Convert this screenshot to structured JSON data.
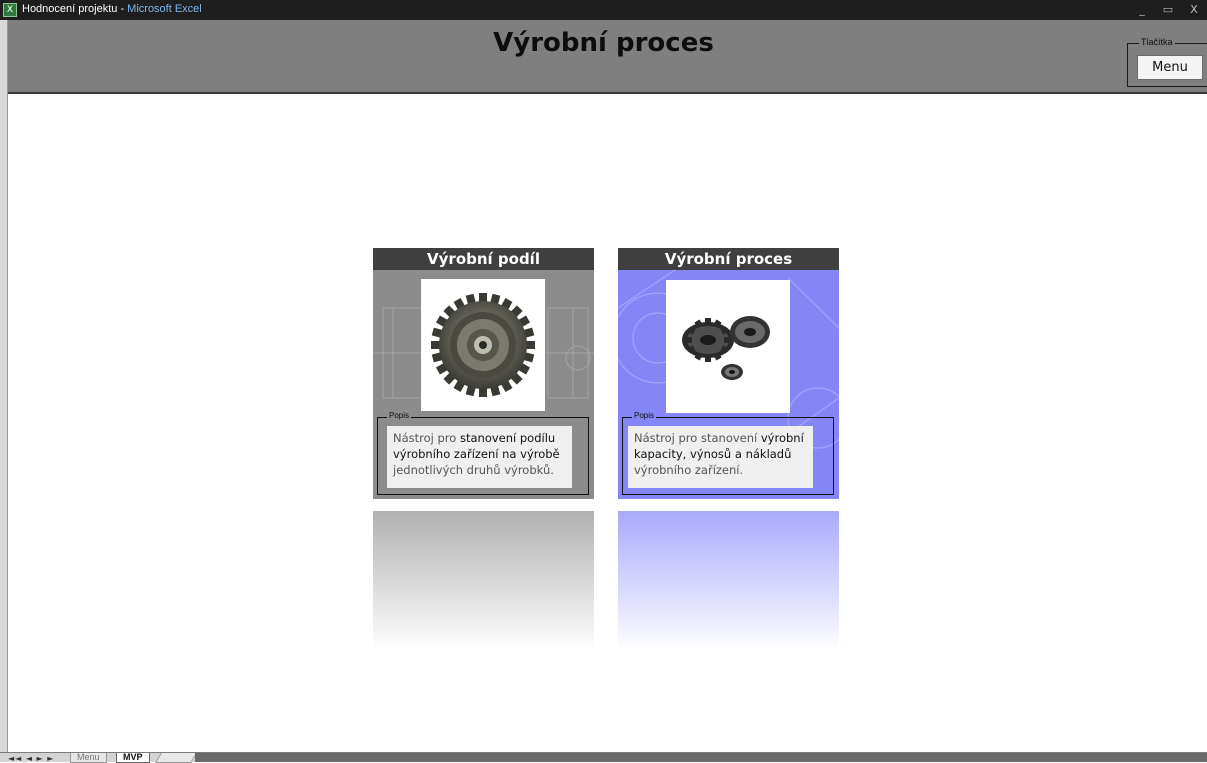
{
  "window": {
    "title_doc": "Hodnocení projektu - ",
    "title_app": "Microsoft Excel",
    "minimize_glyph": "_",
    "restore_glyph": "▭",
    "close_glyph": "X"
  },
  "header": {
    "title": "Výrobní proces"
  },
  "buttons_group": {
    "label": "Tlačítka",
    "menu_label": "Menu"
  },
  "cards": [
    {
      "title": "Výrobní podíl",
      "popis_label": "Popis",
      "desc_1": "Nástroj pro ",
      "desc_2": "stanovení podílu výrobního zařízení na výrobě",
      "desc_3": " jednotlivých druhů výrobků.",
      "image_icon": "gear-assembly-photo",
      "color": "#8c8c8c"
    },
    {
      "title": "Výrobní proces",
      "popis_label": "Popis",
      "desc_1": "Nástroj pro stanovení ",
      "desc_2": "výrobní kapacity, výnosů a nákladů",
      "desc_3": " výrobního zařízení.",
      "image_icon": "gears-photo",
      "color": "#8585f6"
    }
  ],
  "sheet_tabs": {
    "nav_glyphs": "◄◄ ◄ ► ►",
    "tabs": [
      "Menu",
      "MVP"
    ],
    "active": "MVP"
  }
}
